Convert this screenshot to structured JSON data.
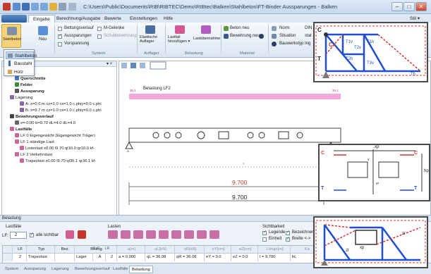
{
  "window": {
    "title": "C:\\Users\\Public\\Documents\\RIB\\RIBTEC\\Demo\\RIBtec\\Balken\\Stahlbeton\\FT-Binder Aussparungen - Balken",
    "minimize": "–",
    "maximize": "□",
    "close": "✕"
  },
  "ribbon_tabs": [
    {
      "label": "Eingabe",
      "active": true
    },
    {
      "label": "Berechnung/Ausgabe"
    },
    {
      "label": "Bewerte"
    },
    {
      "label": "Einstellungen"
    },
    {
      "label": "Hilfe"
    }
  ],
  "style_label": "Stil ▾",
  "ribbon": {
    "stahlbeton": "Stahlbeton",
    "neu": "Neu",
    "checks": [
      {
        "label": "Bettungsverlauf",
        "checked": false
      },
      {
        "label": "M-Gelenke",
        "checked": false
      },
      {
        "label": "Aussparungen",
        "checked": true
      },
      {
        "label": "Schubbewehrung",
        "checked": false
      },
      {
        "label": "Vorspannung",
        "checked": false
      }
    ],
    "group_system": "System",
    "elastische": "Elastische\nAuflager",
    "group_auflager": "Auflager",
    "lastfall": "Lastfall\nhinzufügen ▾",
    "lastubernahme": "Lastübernahme",
    "group_belastung": "Belastung",
    "beton_neu": "Beton neu",
    "bewehrung_neu": "Bewehrung neu",
    "group_material": "Material",
    "norm": "Norm",
    "norm_val": "DIN",
    "situation": "Situation",
    "situation_val": "stat",
    "bauwerkstyp": "Bauwerkstyp",
    "bauwerkstyp_val": "Ing",
    "gruppe_schnitt": "schnitt"
  },
  "dropdown": {
    "items": [
      {
        "label": "Stahlbeton",
        "selected": true
      },
      {
        "label": "Baustahl"
      },
      {
        "label": "Holz"
      }
    ]
  },
  "tree": {
    "items": [
      {
        "label": "System",
        "indent": 1,
        "bold": true,
        "color": "#5577aa"
      },
      {
        "label": "Querschnitte",
        "indent": 2,
        "bold": true,
        "color": "#4477cc"
      },
      {
        "label": "Felder",
        "indent": 2,
        "bold": true,
        "color": "#3a8a3a"
      },
      {
        "label": "Aussparung",
        "indent": 2,
        "bold": true,
        "color": "#555555"
      },
      {
        "label": "Lagerung",
        "indent": 1,
        "bold": false,
        "color": "#8866aa"
      },
      {
        "label": "A: x=0.0 m  cz=1.0 cx=1.0 c.phiy=0.0 c.phi",
        "indent": 3,
        "bold": false,
        "color": "#8866aa"
      },
      {
        "label": "B: x=9.7 m  cz=1.0 cx=1.0 c.phiy=0.0 c.phi",
        "indent": 3,
        "bold": false,
        "color": "#8866aa"
      },
      {
        "label": "Bewehrungsverlauf",
        "indent": 1,
        "bold": true,
        "color": "#444444"
      },
      {
        "label": "x=-0.00 b=9.70 dL=4.0 dL=4.0",
        "indent": 2,
        "bold": false,
        "color": "#666666"
      },
      {
        "label": "Lastfälle",
        "indent": 1,
        "bold": true,
        "color": "#cc6699"
      },
      {
        "label": "LF 0 Eigengewicht (Eigengewicht Träger)",
        "indent": 2,
        "bold": false,
        "color": "#cc6699"
      },
      {
        "label": "LF 1 ständige Last",
        "indent": 2,
        "bold": false,
        "color": "#cc6699"
      },
      {
        "label": "Linienlast x0.00 l9.70 ql10.0 qr10.0 kf-",
        "indent": 3,
        "bold": false,
        "color": "#cc6699"
      },
      {
        "label": "LF 2 Verkehrslast",
        "indent": 2,
        "bold": false,
        "color": "#cc6699"
      },
      {
        "label": "Trapezlast x0.00 l9.70 ql36.1 qr36.1 kf-",
        "indent": 3,
        "bold": false,
        "color": "#cc6699"
      }
    ]
  },
  "canvas": {
    "belastung": "Belastung LF2",
    "load_left": "36.1",
    "load_right": "36.1",
    "support_a": "A",
    "support_b": "B",
    "dim_red": "9.700",
    "dim_black": "9.700",
    "axis_label": "x"
  },
  "bottom": {
    "title": "Belastung",
    "lastfalle": "Lastfälle",
    "lf_label": "LF:",
    "lf_value": "2",
    "alle_sichtbar": "alle sichtbar",
    "lasten": "Lasten",
    "sichtbarkeit": "Sichtbarkeit",
    "legende": "Legende",
    "bezeichner": "Bezeichner",
    "einheit": "Einheit",
    "breite": "Breite <->",
    "headers": [
      "LF",
      "Typ",
      "Bez.",
      "Bezug",
      "a[m]",
      "qL[kN]",
      "qR[kN]",
      "eY[cm]",
      "eZ[cm]",
      "Länge[m]",
      "Ka"
    ],
    "subheaders": [
      "BzP",
      "LR"
    ],
    "row": {
      "lf": "2",
      "typ": "Trapezlast",
      "bez": "",
      "bezug": "Lager",
      "bzp": "A",
      "lr": "2",
      "a": "a = 0.000",
      "ql": "qL = 36.08",
      "qr": "qR = 36.08",
      "ey": "eY = 0.0",
      "ez": "eZ = 0.0",
      "laenge": "l = 9.700",
      "ka": "bL"
    }
  },
  "bottom_tabs": [
    {
      "label": "System"
    },
    {
      "label": "Aussparung"
    },
    {
      "label": "Lagerung"
    },
    {
      "label": "Bewehrungsverlauf"
    },
    {
      "label": "Lastfälle"
    },
    {
      "label": "Belastung",
      "active": true
    }
  ],
  "callout1": {
    "labels": [
      "C",
      "T",
      "C",
      "T1v",
      "T2v",
      "T2h",
      "T3v",
      "T1h",
      "Th"
    ]
  },
  "callout2": {
    "c_left": "C",
    "c_right": "C",
    "t_left": "T",
    "t_right": "T",
    "xp": "xp",
    "hp": "hp",
    "v": "v",
    "vr": "vr"
  },
  "callout3": {
    "zr": "zr",
    "zl": "zl",
    "xp": "xp"
  }
}
